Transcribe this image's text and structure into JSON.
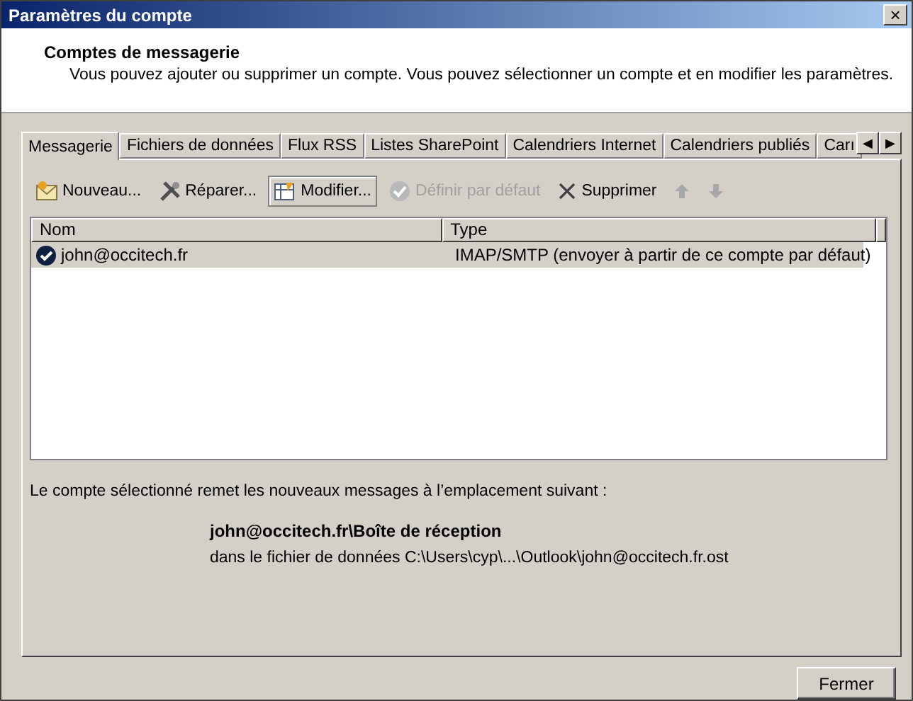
{
  "window": {
    "title": "Paramètres du compte",
    "close": "×"
  },
  "header": {
    "title": "Comptes de messagerie",
    "description": "Vous pouvez ajouter ou supprimer un compte. Vous pouvez sélectionner un compte et en modifier les paramètres."
  },
  "tabs": [
    {
      "label": "Messagerie",
      "selected": true
    },
    {
      "label": "Fichiers de données",
      "selected": false
    },
    {
      "label": "Flux RSS",
      "selected": false
    },
    {
      "label": "Listes SharePoint",
      "selected": false
    },
    {
      "label": "Calendriers Internet",
      "selected": false
    },
    {
      "label": "Calendriers publiés",
      "selected": false
    },
    {
      "label": "Carı",
      "selected": false
    }
  ],
  "tab_scroll": [
    "◀",
    "▶"
  ],
  "toolbar": [
    {
      "kind": "new",
      "label": "Nouveau...",
      "disabled": false,
      "pressed": false
    },
    {
      "kind": "repair",
      "label": "Réparer...",
      "disabled": false,
      "pressed": false
    },
    {
      "kind": "change",
      "label": "Modifier...",
      "disabled": false,
      "pressed": true
    },
    {
      "kind": "default",
      "label": "Définir par défaut",
      "disabled": true,
      "pressed": false
    },
    {
      "kind": "remove",
      "label": "Supprimer",
      "disabled": false,
      "pressed": false
    },
    {
      "kind": "up",
      "disabled": true,
      "pressed": false
    },
    {
      "kind": "down",
      "disabled": true,
      "pressed": false
    }
  ],
  "table": {
    "columns": [
      "Nom",
      "Type"
    ],
    "rows": [
      {
        "name": "john@occitech.fr",
        "type": "IMAP/SMTP (envoyer à partir de ce compte par défaut)",
        "selected": true,
        "default": true
      }
    ]
  },
  "delivery": {
    "intro": "Le compte sélectionné remet les nouveaux messages à l’emplacement suivant :",
    "location": "john@occitech.fr\\Boîte de réception",
    "file": "dans le fichier de données C:\\Users\\cyp\\...\\Outlook\\john@occitech.fr.ost"
  },
  "buttons": [
    "Fermer"
  ]
}
